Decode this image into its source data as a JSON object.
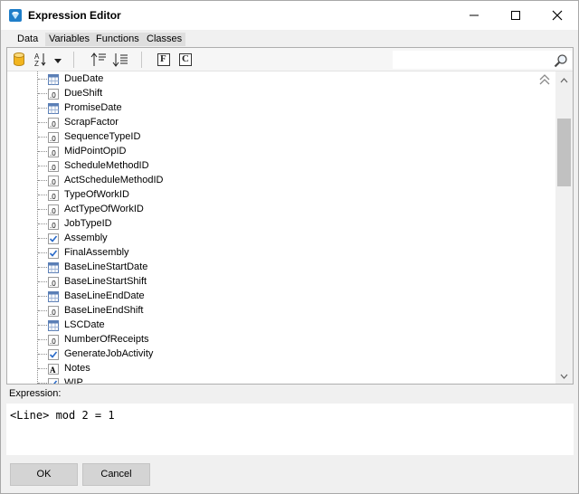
{
  "window": {
    "title": "Expression Editor",
    "icon": "diamond-app-icon"
  },
  "tabs": [
    {
      "label": "Data",
      "active": true
    },
    {
      "label": "Variables",
      "active": false
    },
    {
      "label": "Functions",
      "active": false
    },
    {
      "label": "Classes",
      "active": false
    }
  ],
  "toolbar": {
    "database_icon": "database-icon",
    "sort_icon": "sort-az-icon",
    "move_up_icon": "move-top-icon",
    "move_down_icon": "move-bottom-icon",
    "fields_button": "F",
    "classes_button": "C",
    "search_value": ""
  },
  "tree": {
    "items": [
      {
        "label": "DueDate",
        "type": "date"
      },
      {
        "label": "DueShift",
        "type": "number"
      },
      {
        "label": "PromiseDate",
        "type": "date"
      },
      {
        "label": "ScrapFactor",
        "type": "number"
      },
      {
        "label": "SequenceTypeID",
        "type": "number"
      },
      {
        "label": "MidPointOpID",
        "type": "number"
      },
      {
        "label": "ScheduleMethodID",
        "type": "number"
      },
      {
        "label": "ActScheduleMethodID",
        "type": "number"
      },
      {
        "label": "TypeOfWorkID",
        "type": "number"
      },
      {
        "label": "ActTypeOfWorkID",
        "type": "number"
      },
      {
        "label": "JobTypeID",
        "type": "number"
      },
      {
        "label": "Assembly",
        "type": "boolean"
      },
      {
        "label": "FinalAssembly",
        "type": "boolean"
      },
      {
        "label": "BaseLineStartDate",
        "type": "date"
      },
      {
        "label": "BaseLineStartShift",
        "type": "number"
      },
      {
        "label": "BaseLineEndDate",
        "type": "date"
      },
      {
        "label": "BaseLineEndShift",
        "type": "number"
      },
      {
        "label": "LSCDate",
        "type": "date"
      },
      {
        "label": "NumberOfReceipts",
        "type": "number"
      },
      {
        "label": "GenerateJobActivity",
        "type": "boolean"
      },
      {
        "label": "Notes",
        "type": "text"
      },
      {
        "label": "WIP",
        "type": "boolean"
      }
    ]
  },
  "expression": {
    "label": "Expression:",
    "value": "<Line> mod 2 = 1"
  },
  "buttons": {
    "ok": "OK",
    "cancel": "Cancel"
  },
  "colors": {
    "titlebar": "#ffffff",
    "window_bg": "#f0f0f0",
    "checkbox_blue": "#2a6ac8",
    "date_icon_blue": "#5b7fb6"
  }
}
